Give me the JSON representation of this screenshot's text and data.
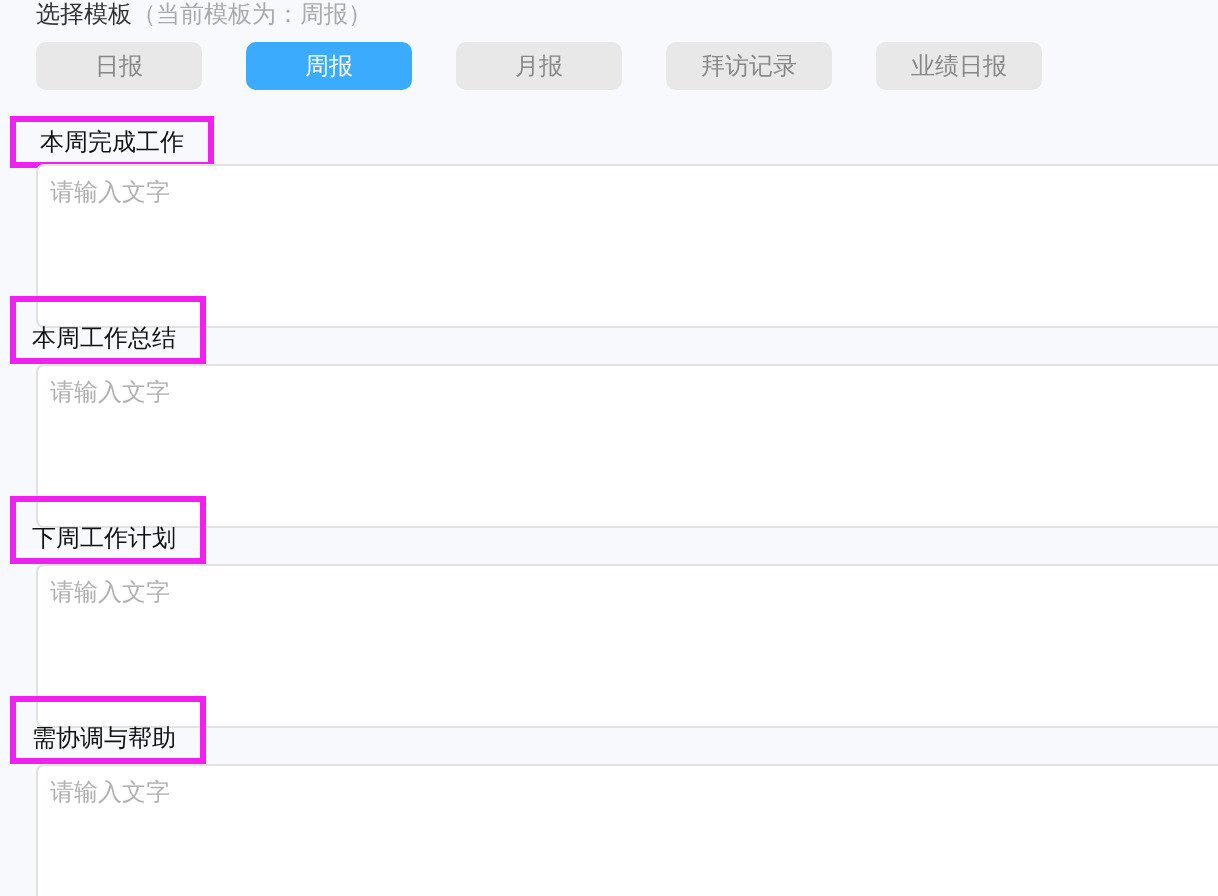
{
  "header": {
    "title": "选择模板",
    "note": "（当前模板为：周报）"
  },
  "tabs": [
    {
      "label": "日报",
      "selected": false
    },
    {
      "label": "周报",
      "selected": true
    },
    {
      "label": "月报",
      "selected": false
    },
    {
      "label": "拜访记录",
      "selected": false
    },
    {
      "label": "业绩日报",
      "selected": false
    }
  ],
  "sections": [
    {
      "title": "本周完成工作",
      "marked": true,
      "placeholder": "请输入文字"
    },
    {
      "title": "本周工作总结",
      "marked": true,
      "placeholder": "请输入文字"
    },
    {
      "title": "下周工作计划",
      "marked": true,
      "placeholder": "请输入文字"
    },
    {
      "title": "需协调与帮助",
      "marked": true,
      "placeholder": "请输入文字"
    }
  ]
}
